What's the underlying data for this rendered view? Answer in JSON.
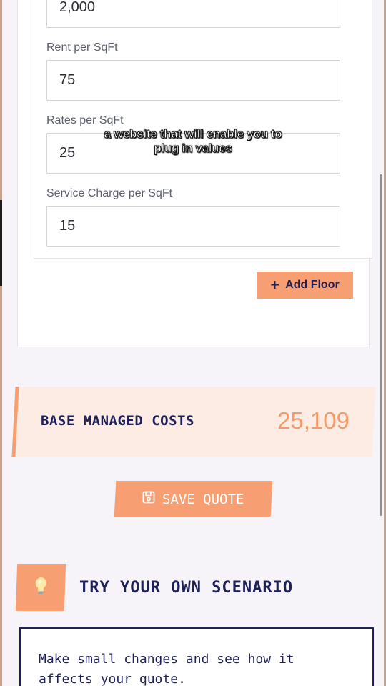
{
  "fields": {
    "area_value": "2,000",
    "rent_label": "Rent per SqFt",
    "rent_value": "75",
    "rates_label": "Rates per SqFt",
    "rates_value": "25",
    "service_label": "Service Charge per SqFt",
    "service_value": "15"
  },
  "add_floor": {
    "icon": "plus-icon",
    "label": "Add Floor"
  },
  "caption": {
    "line1": "a website that will enable you to",
    "line2": "plug in values"
  },
  "base_costs": {
    "label": "BASE MANAGED COSTS",
    "value": "25,109"
  },
  "save_quote": {
    "icon": "floppy-disk-icon",
    "label": "SAVE QUOTE"
  },
  "scenario": {
    "icon": "lightbulb-icon",
    "title": "TRY YOUR OWN SCENARIO",
    "description_line1": "Make small changes and see how it",
    "description_line2": "affects your quote."
  },
  "colors": {
    "accent": "#f79f72",
    "navy": "#1e2158",
    "base_bg": "#fcece4",
    "value_orange": "#f49b6b"
  }
}
